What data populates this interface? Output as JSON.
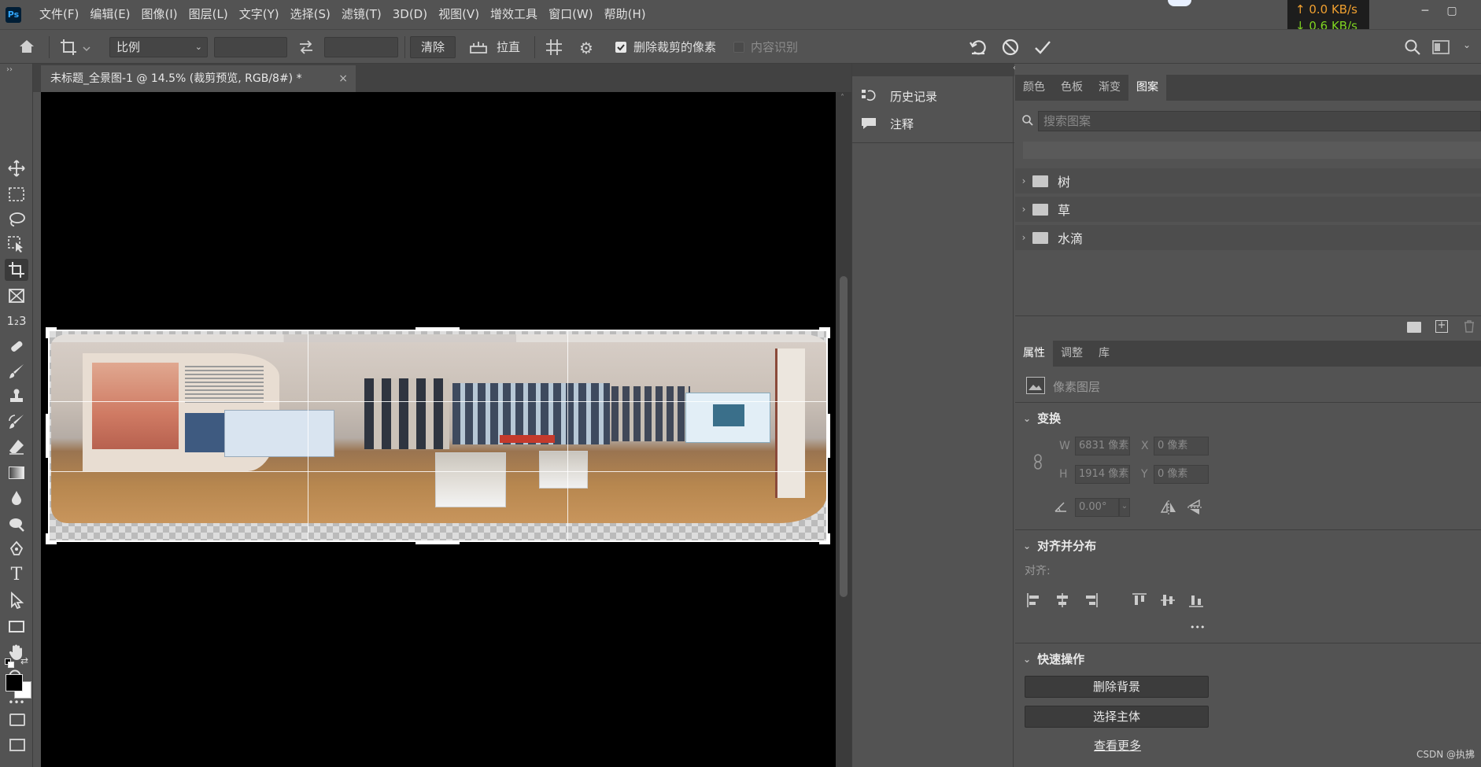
{
  "menubar": {
    "logo": "Ps",
    "items": [
      "文件(F)",
      "编辑(E)",
      "图像(I)",
      "图层(L)",
      "文字(Y)",
      "选择(S)",
      "滤镜(T)",
      "3D(D)",
      "视图(V)",
      "增效工具",
      "窗口(W)",
      "帮助(H)"
    ],
    "net_up": "↑ 0.0 KB/s",
    "net_down": "↓ 0.6 KB/s"
  },
  "options": {
    "ratio_select": "比例",
    "ratio_w": "",
    "ratio_h": "",
    "clear_label": "清除",
    "straighten_label": "拉直",
    "delete_cropped_label": "删除裁剪的像素",
    "delete_cropped_checked": true,
    "content_aware_label": "内容识别",
    "content_aware_checked": false
  },
  "document": {
    "tab_title": "未标题_全景图-1 @ 14.5% (裁剪预览, RGB/8#) *",
    "close_glyph": "×"
  },
  "toolbar": {
    "tools": [
      "move-tool",
      "marquee-tool",
      "lasso-tool",
      "object-select-tool",
      "crop-tool",
      "frame-tool",
      "counter-tool",
      "healing-brush-tool",
      "brush-tool",
      "stamp-tool",
      "history-brush-tool",
      "eraser-tool",
      "gradient-tool",
      "blur-tool",
      "dodge-tool",
      "pen-tool",
      "type-tool",
      "path-select-tool",
      "rectangle-tool",
      "hand-tool",
      "zoom-tool",
      "more-tools"
    ],
    "counter_glyph": "1₂3",
    "type_glyph": "T",
    "more_glyph": "•••"
  },
  "midpanel": {
    "items": [
      {
        "label": "历史记录",
        "icon": "history-icon"
      },
      {
        "label": "注释",
        "icon": "comment-icon"
      }
    ]
  },
  "rightpanel": {
    "top_tabs": [
      "颜色",
      "色板",
      "渐变",
      "图案"
    ],
    "active_top_tab": 3,
    "search_placeholder": "搜索图案",
    "folders": [
      "树",
      "草",
      "水滴"
    ],
    "prop_tabs": [
      "属性",
      "调整",
      "库"
    ],
    "active_prop_tab": 0,
    "layer_type": "像素图层",
    "transform_title": "变换",
    "w_label": "W",
    "w_value": "6831 像素",
    "x_label": "X",
    "x_value": "0 像素",
    "h_label": "H",
    "h_value": "1914 像素",
    "y_label": "Y",
    "y_value": "0 像素",
    "angle_value": "0.00°",
    "align_title": "对齐并分布",
    "align_label": "对齐:",
    "more_glyph": "•••",
    "quick_title": "快速操作",
    "remove_bg": "删除背景",
    "select_subject": "选择主体",
    "see_more": "查看更多"
  },
  "watermark": "CSDN @执拂"
}
